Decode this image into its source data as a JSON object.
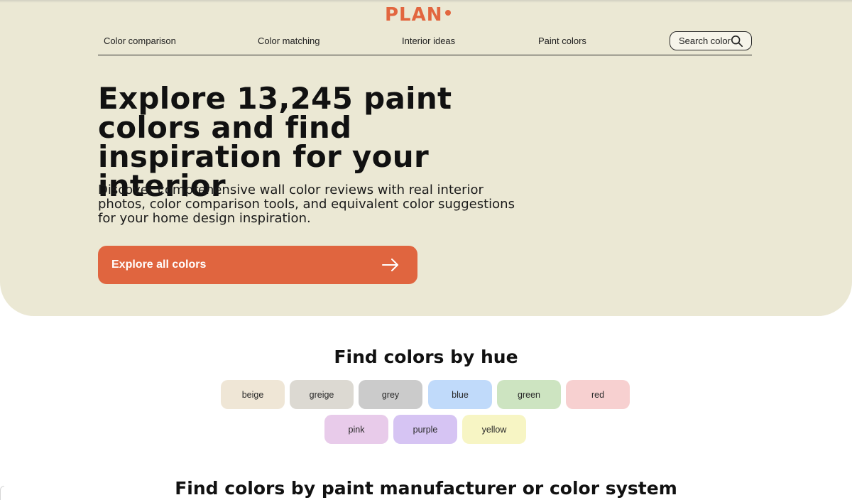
{
  "brand": {
    "logo_text": "PLAN",
    "accent_color": "#e2663f"
  },
  "nav": {
    "items": [
      {
        "label": "Color comparison"
      },
      {
        "label": "Color matching"
      },
      {
        "label": "Interior ideas"
      },
      {
        "label": "Paint colors"
      }
    ],
    "search": {
      "label": "Search color",
      "icon": "search-icon"
    }
  },
  "hero": {
    "headline": "Explore 13,245 paint colors and find inspiration for your interior",
    "subtext": "Discover comprehensive wall color reviews with real interior photos, color comparison tools, and equivalent color suggestions for your home design inspiration.",
    "cta_label": "Explore all colors",
    "cta_icon": "arrow-right-icon",
    "background": "#ebe8d4",
    "cta_color": "#e0653f"
  },
  "hues": {
    "title": "Find colors by hue",
    "chips": [
      {
        "label": "beige",
        "color": "#efe6d6"
      },
      {
        "label": "greige",
        "color": "#dcd9d2"
      },
      {
        "label": "grey",
        "color": "#cbcbcb"
      },
      {
        "label": "blue",
        "color": "#c0dafa"
      },
      {
        "label": "green",
        "color": "#cde4c1"
      },
      {
        "label": "red",
        "color": "#f7d0d0"
      },
      {
        "label": "pink",
        "color": "#e8cbea"
      },
      {
        "label": "purple",
        "color": "#d6c4f3"
      },
      {
        "label": "yellow",
        "color": "#f7f5c4"
      }
    ]
  },
  "manufacturers": {
    "title": "Find colors by paint manufacturer or color system"
  }
}
